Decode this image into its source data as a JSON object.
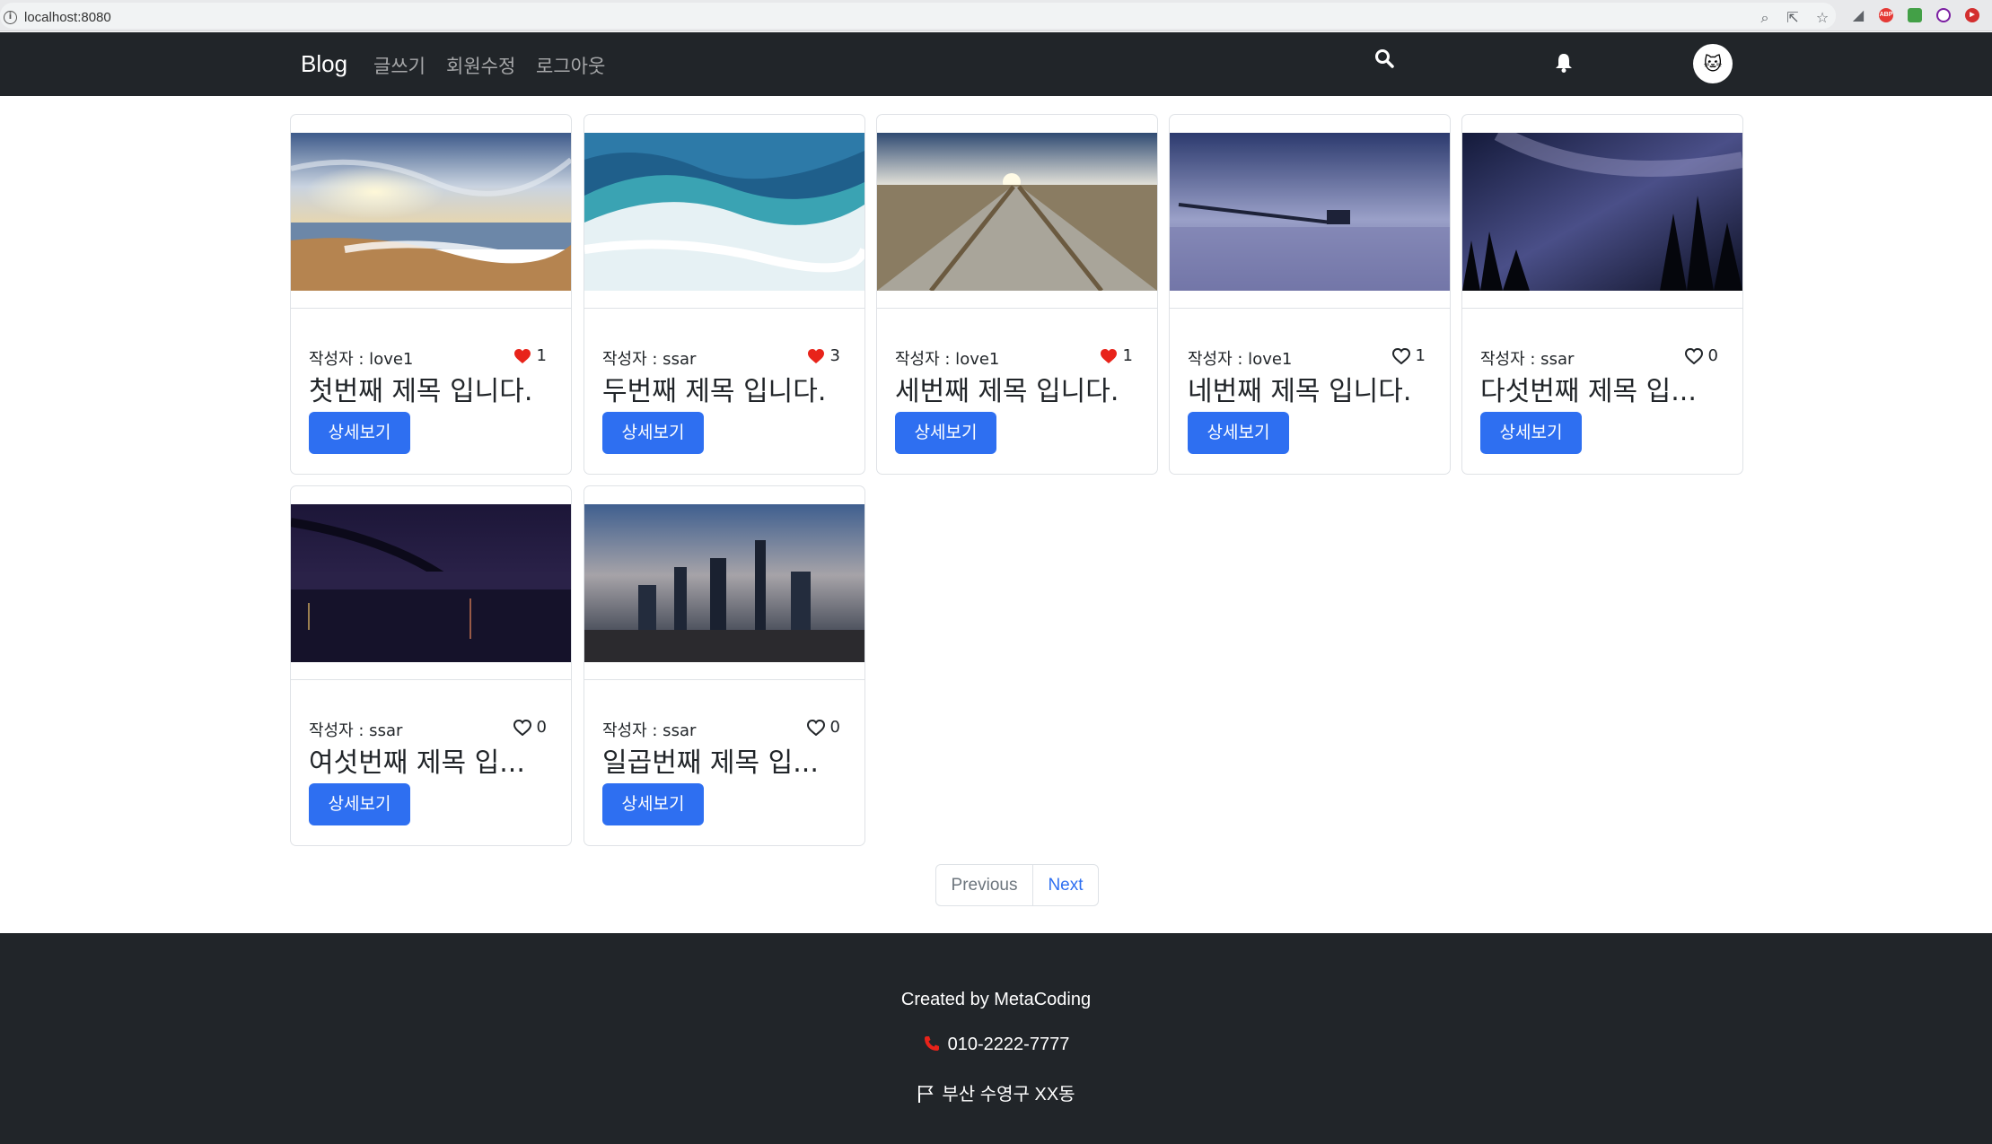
{
  "browser": {
    "url": "localhost:8080"
  },
  "navbar": {
    "brand": "Blog",
    "links": [
      "글쓰기",
      "회원수정",
      "로그아웃"
    ],
    "search_icon": "search-icon",
    "bell_icon": "bell-icon",
    "avatar_icon": "avatar-icon"
  },
  "posts": [
    {
      "author_label": "작성자 : love1",
      "likes": "1",
      "liked": true,
      "title": "첫번째 제목 입니다.",
      "button": "상세보기",
      "image": "sunset-beach"
    },
    {
      "author_label": "작성자 : ssar",
      "likes": "3",
      "liked": true,
      "title": "두번째 제목 입니다.",
      "button": "상세보기",
      "image": "ocean-wave"
    },
    {
      "author_label": "작성자 : love1",
      "likes": "1",
      "liked": true,
      "title": "세번째 제목 입니다.",
      "button": "상세보기",
      "image": "railroad-tracks"
    },
    {
      "author_label": "작성자 : love1",
      "likes": "1",
      "liked": false,
      "title": "네번째 제목 입니다.",
      "button": "상세보기",
      "image": "pier-at-dusk"
    },
    {
      "author_label": "작성자 : ssar",
      "likes": "0",
      "liked": false,
      "title": "다섯번째 제목 입...",
      "button": "상세보기",
      "image": "milky-way-forest"
    },
    {
      "author_label": "작성자 : ssar",
      "likes": "0",
      "liked": false,
      "title": "여섯번째 제목 입...",
      "button": "상세보기",
      "image": "bridge-city-night"
    },
    {
      "author_label": "작성자 : ssar",
      "likes": "0",
      "liked": false,
      "title": "일곱번째 제목 입...",
      "button": "상세보기",
      "image": "city-skyline-dusk"
    }
  ],
  "pagination": {
    "previous": "Previous",
    "next": "Next"
  },
  "footer": {
    "created_by": "Created by MetaCoding",
    "phone": "010-2222-7777",
    "address": "부산 수영구 XX동"
  },
  "colors": {
    "navbar_bg": "#212529",
    "primary": "#2e6ff1",
    "heart_red": "#e8231a"
  }
}
